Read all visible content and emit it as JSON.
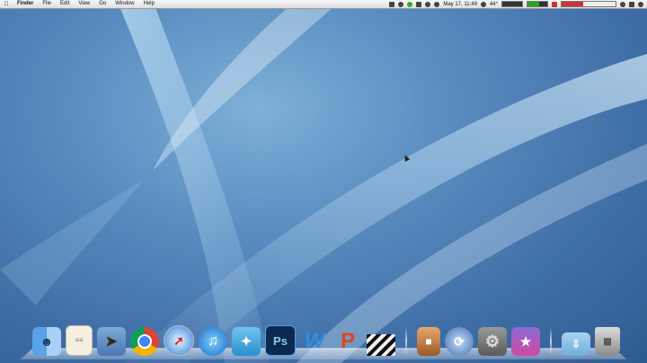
{
  "menubar": {
    "apple": "",
    "app_name": "Finder",
    "items": [
      "File",
      "Edit",
      "View",
      "Go",
      "Window",
      "Help"
    ],
    "clock": "May 17, 11:49",
    "temperature": "44°"
  },
  "dock": {
    "apps": [
      {
        "name": "Finder",
        "icon": "finder-icon"
      },
      {
        "name": "TextEdit",
        "icon": "textedit-icon"
      },
      {
        "name": "Mail",
        "icon": "mail-icon"
      },
      {
        "name": "Chrome",
        "icon": "chrome-icon"
      },
      {
        "name": "Safari",
        "icon": "safari-icon"
      },
      {
        "name": "iTunes",
        "icon": "itunes-icon"
      },
      {
        "name": "Twitter",
        "icon": "twitter-icon"
      },
      {
        "name": "Photoshop",
        "icon": "photoshop-icon"
      },
      {
        "name": "Word",
        "icon": "word-icon"
      },
      {
        "name": "PowerPoint",
        "icon": "powerpoint-icon"
      },
      {
        "name": "Final Cut",
        "icon": "finalcut-icon"
      },
      {
        "name": "Keynote",
        "icon": "keynote-icon"
      },
      {
        "name": "Time Machine",
        "icon": "timemachine-icon"
      },
      {
        "name": "System Preferences",
        "icon": "gear-icon"
      },
      {
        "name": "iMovie",
        "icon": "imovie-icon"
      },
      {
        "name": "Downloads",
        "icon": "folder-icon"
      },
      {
        "name": "Trash",
        "icon": "trash-icon"
      }
    ]
  },
  "glyphs": {
    "photoshop": "Ps",
    "word": "W",
    "powerpoint": "P"
  }
}
